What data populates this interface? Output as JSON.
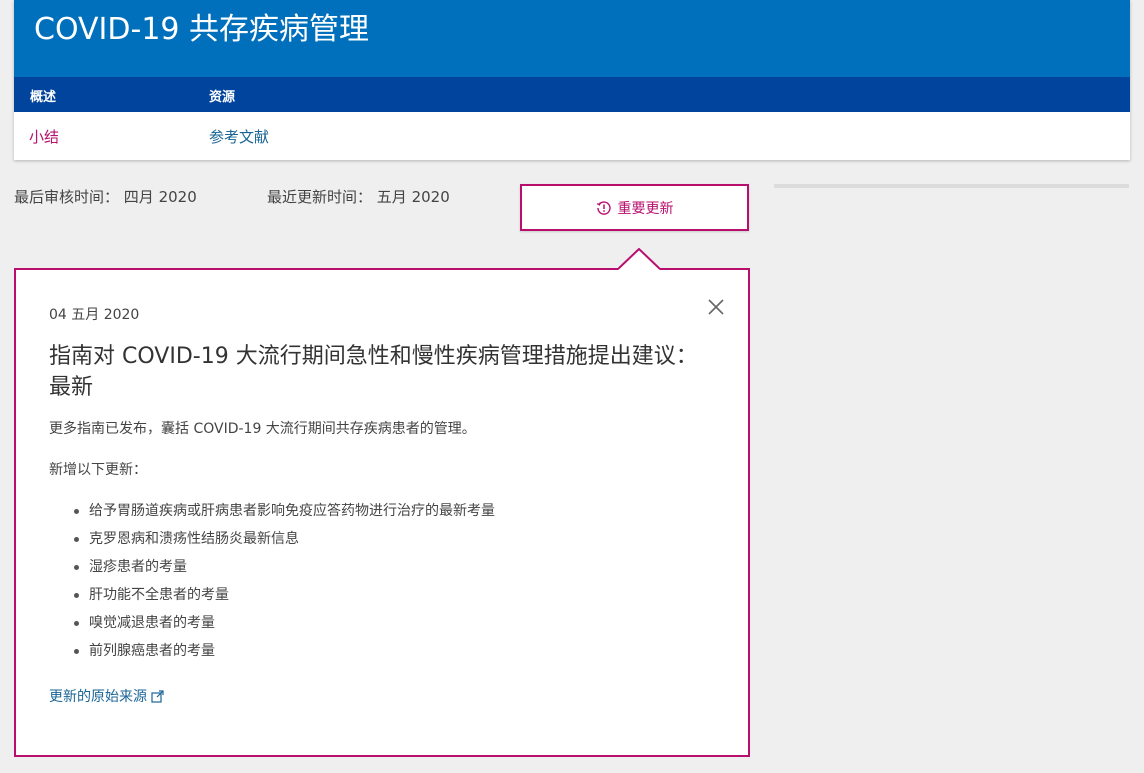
{
  "header": {
    "title": "COVID-19 共存疾病管理",
    "nav": [
      "概述",
      "资源"
    ],
    "sub_links": [
      "小结",
      "参考文献"
    ]
  },
  "meta": {
    "reviewed_label": "最后审核时间：",
    "reviewed_value": "四月 2020",
    "updated_label": "最近更新时间：",
    "updated_value": "五月  2020"
  },
  "update_button": {
    "label": "重要更新",
    "icon": "history-alert-icon"
  },
  "popup": {
    "date": "04 五月 2020",
    "title": "指南对 COVID-19 大流行期间急性和慢性疾病管理措施提出建议：最新",
    "intro": "更多指南已发布，囊括 COVID-19 大流行期间共存疾病患者的管理。",
    "subheading": "新增以下更新：",
    "items": [
      "给予胃肠道疾病或肝病患者影响免疫应答药物进行治疗的最新考量",
      "克罗恩病和溃疡性结肠炎最新信息",
      "湿疹患者的考量",
      "肝功能不全患者的考量",
      "嗅觉减退患者的考量",
      "前列腺癌患者的考量"
    ],
    "source_link": "更新的原始来源",
    "close_icon": "close-icon"
  },
  "colors": {
    "title_bar": "#0070bd",
    "nav_bar": "#00449e",
    "accent": "#b80f6e",
    "link": "#1a6496"
  }
}
